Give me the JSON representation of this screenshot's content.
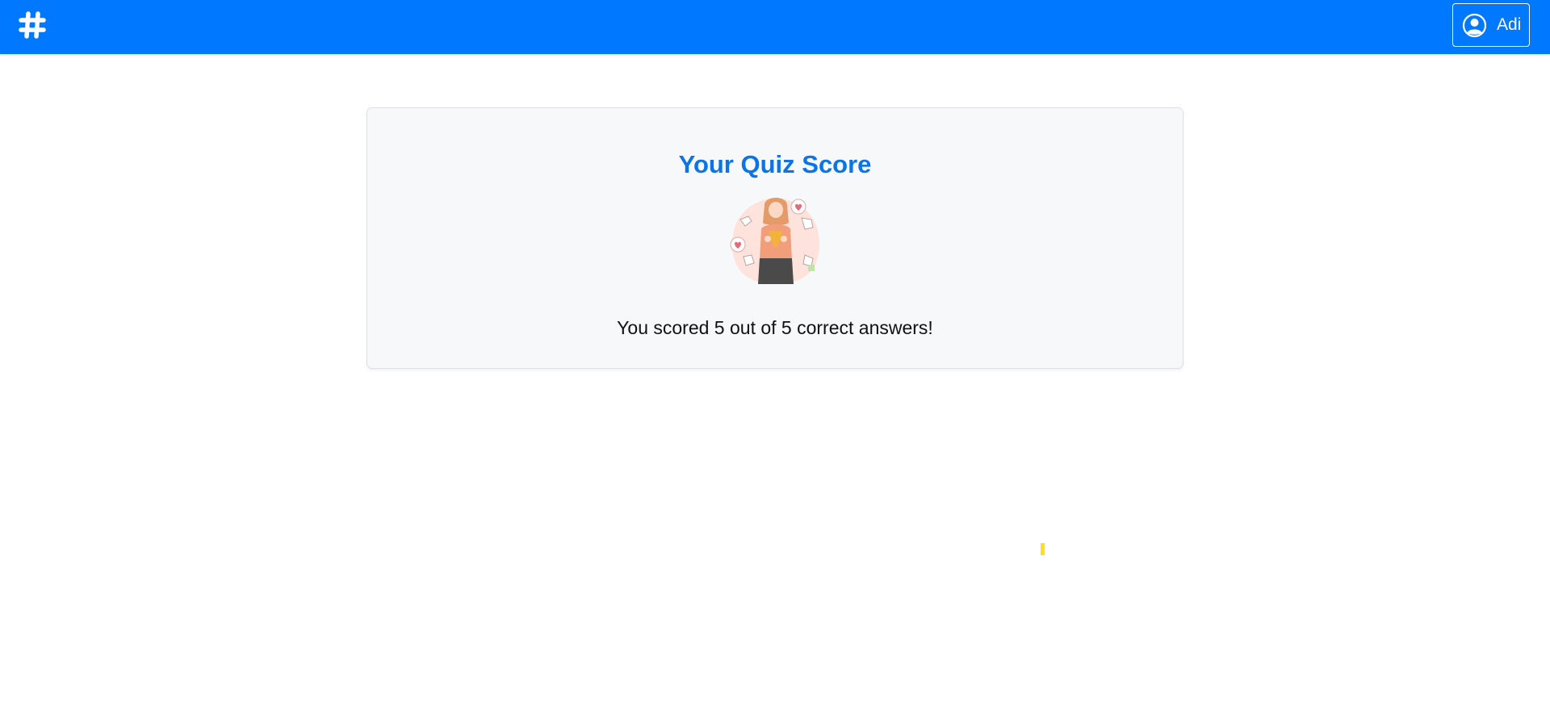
{
  "navbar": {
    "brand_icon": "hashtag-gear-icon",
    "background_color": "#0078ff",
    "user": {
      "icon": "user-circle-icon",
      "name": "Adi"
    }
  },
  "card": {
    "title": "Your Quiz Score",
    "title_color": "#0b74e8",
    "illustration": "celebration-woman-thumbs-up-illustration",
    "score_text": "You scored 5 out of 5 correct answers!"
  }
}
